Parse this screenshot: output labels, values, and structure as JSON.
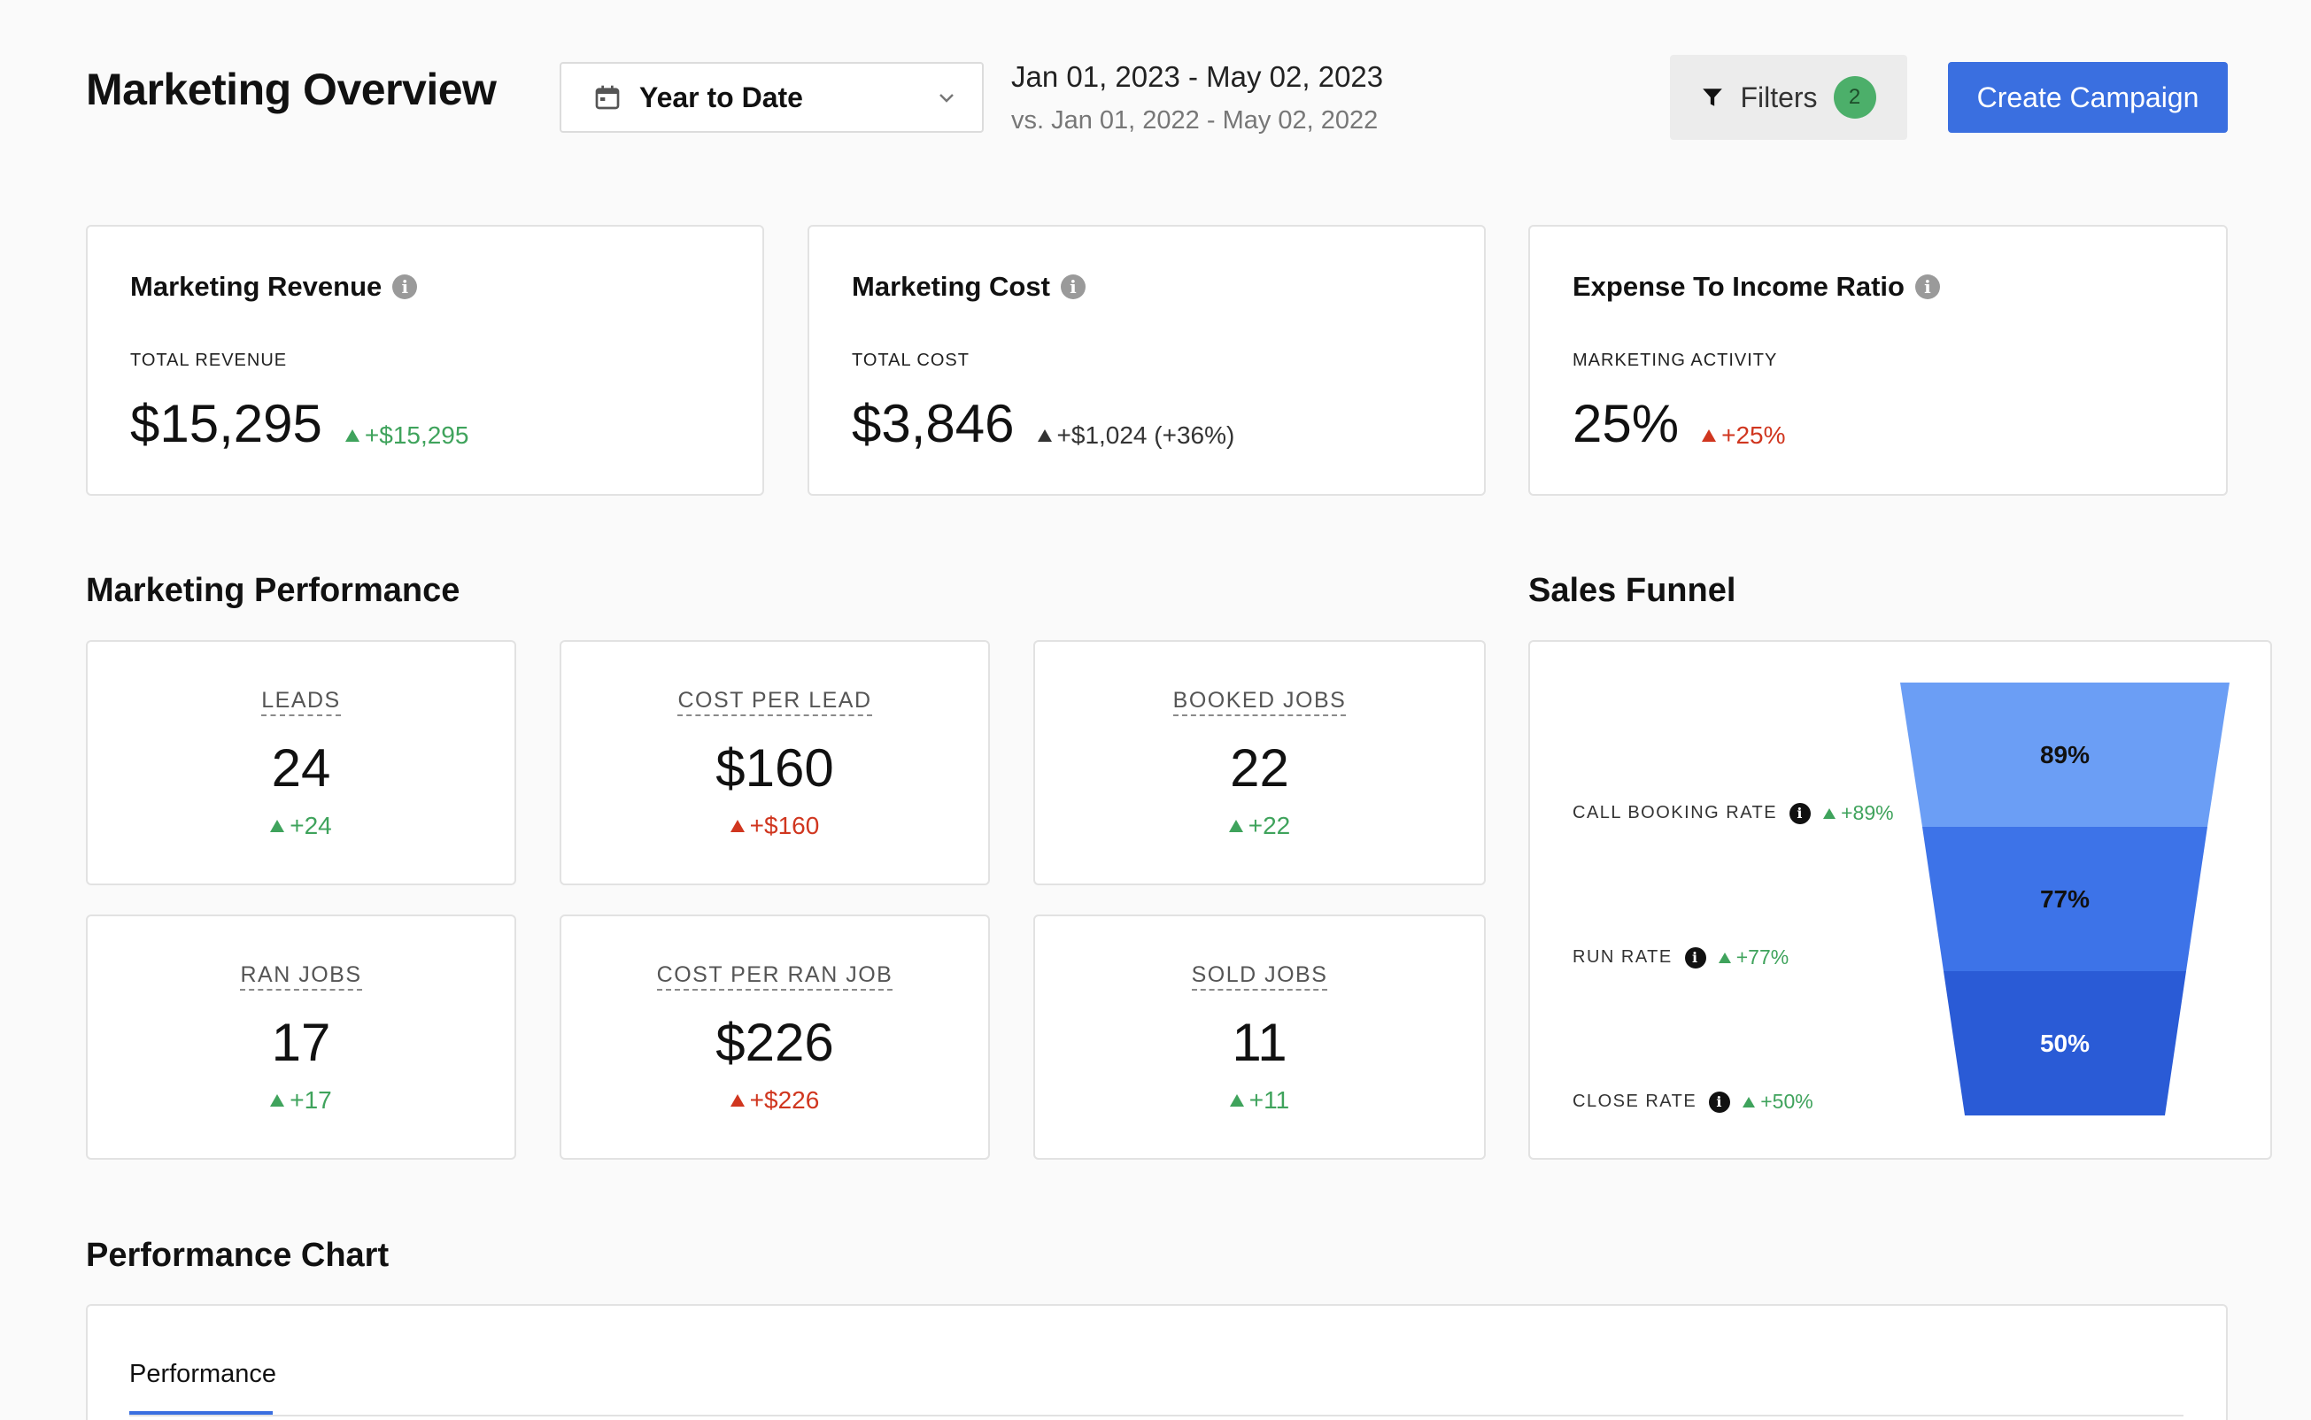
{
  "header": {
    "title": "Marketing Overview",
    "date_select": {
      "label": "Year to Date",
      "icon": "calendar-icon"
    },
    "date_range": "Jan 01, 2023 - May 02, 2023",
    "comparison_range": "vs. Jan 01, 2022 - May 02, 2022",
    "filters": {
      "label": "Filters",
      "count": "2"
    },
    "create_button": "Create Campaign"
  },
  "kpis": {
    "revenue": {
      "title": "Marketing Revenue",
      "sub": "TOTAL REVENUE",
      "value": "$15,295",
      "delta": "+$15,295",
      "delta_color": "green"
    },
    "cost": {
      "title": "Marketing Cost",
      "sub": "TOTAL COST",
      "value": "$3,846",
      "delta": "+$1,024 (+36%)",
      "delta_color": "dark"
    },
    "ratio": {
      "title": "Expense To Income Ratio",
      "sub": "MARKETING ACTIVITY",
      "value": "25%",
      "delta": "+25%",
      "delta_color": "red"
    }
  },
  "performance": {
    "title": "Marketing Performance",
    "metrics": [
      {
        "label": "LEADS",
        "value": "24",
        "delta": "+24"
      },
      {
        "label": "COST PER LEAD",
        "value": "$160",
        "delta": "+$160"
      },
      {
        "label": "BOOKED JOBS",
        "value": "22",
        "delta": "+22"
      },
      {
        "label": "RAN JOBS",
        "value": "17",
        "delta": "+17"
      },
      {
        "label": "COST PER RAN JOB",
        "value": "$226",
        "delta": "+$226"
      },
      {
        "label": "SOLD JOBS",
        "value": "11",
        "delta": "+11"
      }
    ]
  },
  "funnel": {
    "title": "Sales Funnel",
    "stages": [
      {
        "label": "CALL BOOKING RATE",
        "delta": "+89%",
        "value": "89%",
        "color": "#6b9ef5"
      },
      {
        "label": "RUN RATE",
        "delta": "+77%",
        "value": "77%",
        "color": "#3d73e8"
      },
      {
        "label": "CLOSE RATE",
        "delta": "+50%",
        "value": "50%",
        "color": "#2a5bd6"
      }
    ]
  },
  "chart_section": {
    "title": "Performance Chart",
    "tabs": [
      "Performance"
    ]
  },
  "colors": {
    "accent": "#3a6fe0",
    "positive": "#3fa35c",
    "negative": "#d0361f"
  }
}
